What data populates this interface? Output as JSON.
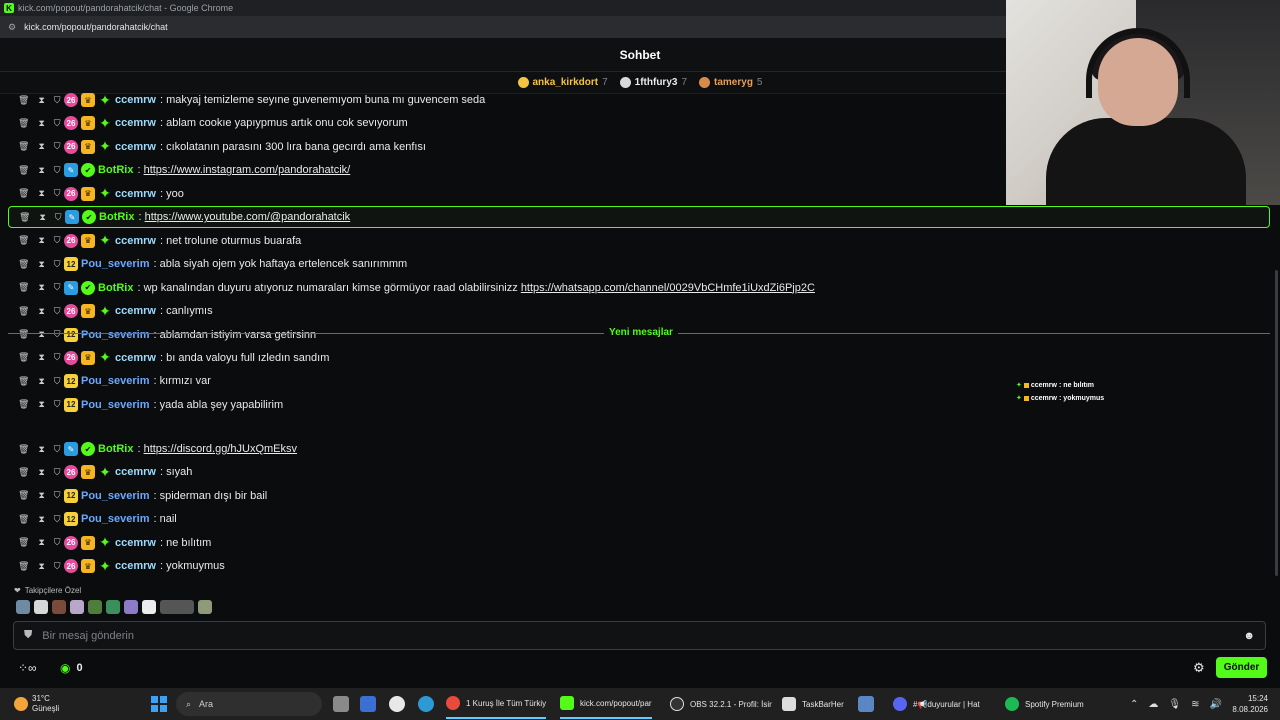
{
  "browser": {
    "window_title": "kick.com/popout/pandorahatcik/chat - Google Chrome",
    "url": "kick.com/popout/pandorahatcik/chat"
  },
  "chat": {
    "header_title": "Sohbet",
    "top_gifters": [
      {
        "name": "anka_kirkdort",
        "count": "7"
      },
      {
        "name": "1fthfury3",
        "count": "7"
      },
      {
        "name": "tameryg",
        "count": "5"
      }
    ],
    "sub_badge": "26",
    "level_badge": "12",
    "messages_before": [
      {
        "user": "ccemrw",
        "text": "makyaj temizleme seyıne guvenemıyom buna mı guvencem seda",
        "link": ""
      },
      {
        "user": "ccemrw",
        "text": "ablam cookıe yapıypmus artık onu cok sevıyorum",
        "link": ""
      },
      {
        "user": "ccemrw",
        "text": "cıkolatanın parasını 300 lıra bana gecırdı ama kenfısı",
        "link": ""
      },
      {
        "user": "BotRix",
        "text": "",
        "link": "https://www.instagram.com/pandorahatcik/"
      },
      {
        "user": "ccemrw",
        "text": "yoo",
        "link": ""
      },
      {
        "user": "BotRix",
        "text": "",
        "link": "https://www.youtube.com/@pandorahatcik"
      },
      {
        "user": "ccemrw",
        "text": "net trolune oturmus buarafa",
        "link": ""
      },
      {
        "user": "Pou_severim",
        "text": "abla siyah ojem yok haftaya ertelencek sanırımmm",
        "link": ""
      },
      {
        "user": "BotRix",
        "text": "wp kanalından duyuru atıyoruz numaraları kimse görmüyor raad olabilirsinizz",
        "link": "https://whatsapp.com/channel/0029VbCHmfe1iUxdZi6Pjp2C"
      },
      {
        "user": "ccemrw",
        "text": "canlıymıs",
        "link": ""
      },
      {
        "user": "Pou_severim",
        "text": "ablamdan istiyim varsa getirsinn",
        "link": ""
      },
      {
        "user": "ccemrw",
        "text": "bı anda valoyu full ızledın sandım",
        "link": ""
      },
      {
        "user": "Pou_severim",
        "text": "kırmızı var",
        "link": ""
      },
      {
        "user": "Pou_severim",
        "text": "yada abla şey yapabilirim",
        "link": ""
      }
    ],
    "new_messages_label": "Yeni mesajlar",
    "messages_after": [
      {
        "user": "BotRix",
        "text": "",
        "link": "https://discord.gg/hJUxQmEksv"
      },
      {
        "user": "ccemrw",
        "text": "sıyah",
        "link": ""
      },
      {
        "user": "Pou_severim",
        "text": "spiderman dışı bir bail",
        "link": ""
      },
      {
        "user": "Pou_severim",
        "text": "nail",
        "link": ""
      },
      {
        "user": "ccemrw",
        "text": "ne bılıtım",
        "link": ""
      },
      {
        "user": "ccemrw",
        "text": "yokmuymus",
        "link": ""
      }
    ],
    "followers_only_label": "Takipçilere Özel",
    "input_placeholder": "Bir mesaj gönderin",
    "points": "0",
    "send_label": "Gönder"
  },
  "stream_overlay": [
    {
      "user": "ccemrw",
      "text": "ne bılıtım"
    },
    {
      "user": "ccemrw",
      "text": "yokmuymus"
    }
  ],
  "taskbar": {
    "weather_temp": "31°C",
    "weather_desc": "Güneşli",
    "search_label": "Ara",
    "apps": [
      {
        "label": "1 Kuruş İle Tüm Türkiy"
      },
      {
        "label": "kick.com/popout/par"
      },
      {
        "label": "OBS 32.2.1 - Profil: İsir"
      },
      {
        "label": "TaskBarHer"
      },
      {
        "label": "#📢duyurular | Hat"
      },
      {
        "label": "Spotify Premium"
      }
    ],
    "time": "15:24",
    "date": "8.08.2026"
  },
  "colors": {
    "kick_green": "#53fc18",
    "user_ccemrw": "#9bdcff",
    "user_pou": "#6aa9ff"
  }
}
